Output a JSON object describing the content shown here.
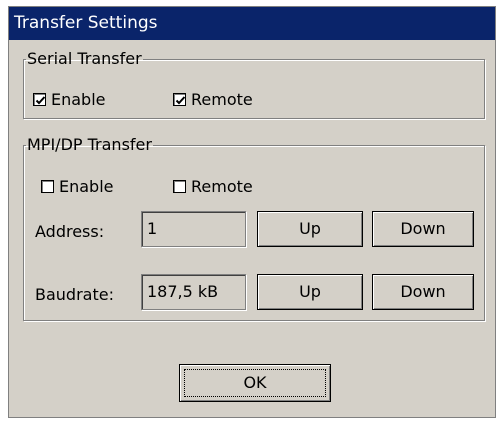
{
  "window": {
    "title": "Transfer Settings"
  },
  "serial": {
    "legend": "Serial Transfer",
    "enable": {
      "label": "Enable",
      "checked": true
    },
    "remote": {
      "label": "Remote",
      "checked": true
    }
  },
  "mpi": {
    "legend": "MPI/DP Transfer",
    "enable": {
      "label": "Enable",
      "checked": false
    },
    "remote": {
      "label": "Remote",
      "checked": false
    },
    "address": {
      "label": "Address:",
      "value": "1",
      "up": "Up",
      "down": "Down"
    },
    "baudrate": {
      "label": "Baudrate:",
      "value": "187,5 kB",
      "up": "Up",
      "down": "Down"
    }
  },
  "ok_label": "OK"
}
